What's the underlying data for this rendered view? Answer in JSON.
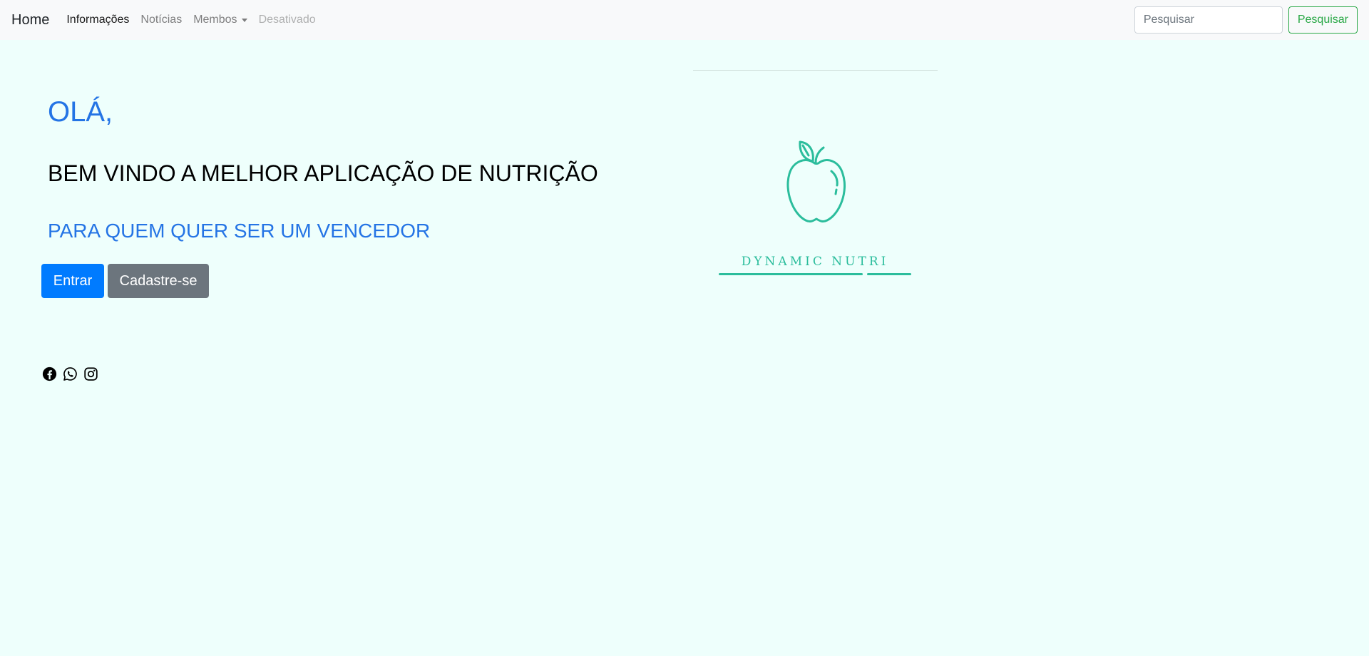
{
  "navbar": {
    "brand": "Home",
    "links": [
      {
        "label": "Informações",
        "state": "active"
      },
      {
        "label": "Notícias",
        "state": "normal"
      },
      {
        "label": "Membos",
        "state": "dropdown"
      },
      {
        "label": "Desativado",
        "state": "disabled"
      }
    ],
    "search": {
      "placeholder": "Pesquisar",
      "value": "",
      "button_label": "Pesquisar"
    }
  },
  "hero": {
    "greeting": "OLÁ,",
    "welcome": "BEM VINDO A MELHOR APLICAÇÃO DE NUTRIÇÃO",
    "tagline": "PARA QUEM QUER SER UM VENCEDOR",
    "primary_button": "Entrar",
    "secondary_button": "Cadastre-se"
  },
  "socials": [
    "facebook-icon",
    "whatsapp-icon",
    "instagram-icon"
  ],
  "logo": {
    "icon": "apple-icon",
    "text": "DYNAMIC NUTRI"
  },
  "colors": {
    "background": "#eefffc",
    "accent_blue": "#2474e5",
    "brand_teal": "#2bbd9c",
    "primary_button": "#007bff",
    "secondary_button": "#6c757d",
    "search_button": "#28a745"
  }
}
